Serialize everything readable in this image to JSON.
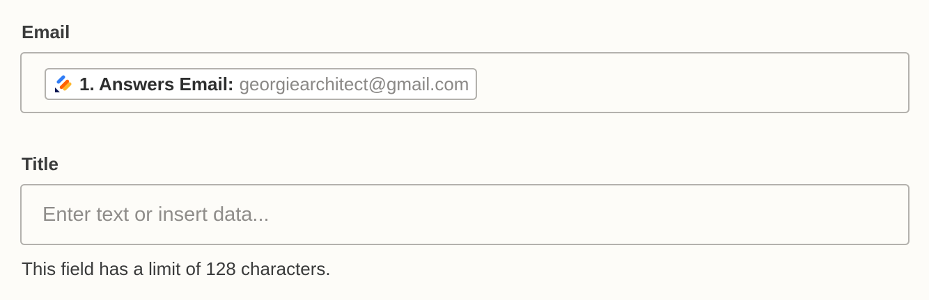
{
  "email": {
    "label": "Email",
    "pill": {
      "icon": "jotform-pencil-icon",
      "key": "1. Answers Email:",
      "value": "georgiearchitect@gmail.com"
    }
  },
  "title": {
    "label": "Title",
    "value": "",
    "placeholder": "Enter text or insert data...",
    "help": "This field has a limit of 128 characters."
  },
  "colors": {
    "background": "#fdfcf8",
    "border": "#b3b1ad",
    "icon_blue": "#2f7cf6",
    "icon_orange": "#ff6100",
    "icon_yellow": "#ffb629",
    "icon_navy": "#0a1551"
  }
}
